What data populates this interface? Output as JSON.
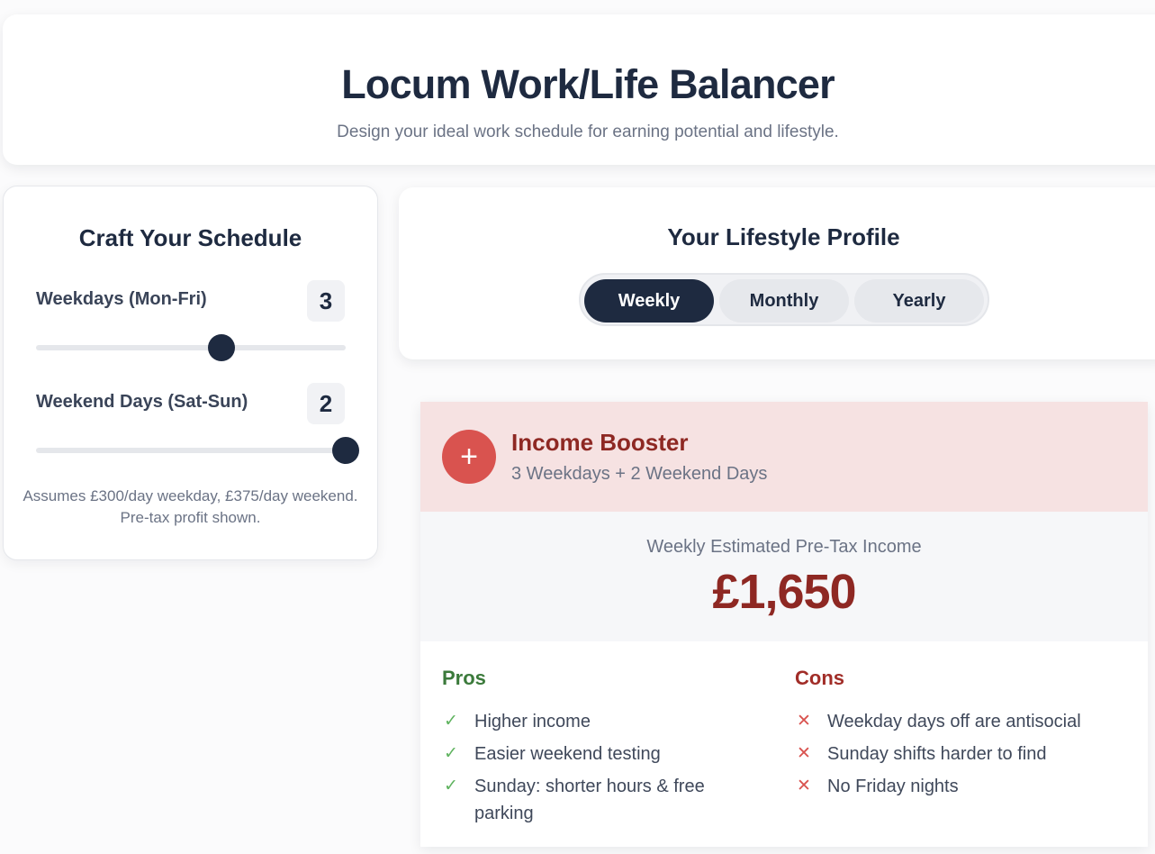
{
  "header": {
    "title": "Locum Work/Life Balancer",
    "subtitle": "Design your ideal work schedule for earning potential and lifestyle."
  },
  "schedule": {
    "title": "Craft Your Schedule",
    "weekdays": {
      "label": "Weekdays (Mon-Fri)",
      "value": "3",
      "level_fraction": 0.6
    },
    "weekend": {
      "label": "Weekend Days (Sat-Sun)",
      "value": "2",
      "level_fraction": 1.0
    },
    "assumption": "Assumes £300/day weekday, £375/day weekend. Pre-tax profit shown."
  },
  "profile": {
    "title": "Your Lifestyle Profile",
    "tabs": [
      {
        "label": "Weekly",
        "active": true
      },
      {
        "label": "Monthly",
        "active": false
      },
      {
        "label": "Yearly",
        "active": false
      }
    ]
  },
  "result": {
    "icon": "plus-icon",
    "title": "Income Booster",
    "subtitle": "3 Weekdays + 2 Weekend Days",
    "income_label": "Weekly Estimated Pre-Tax Income",
    "income_value": "£1,650",
    "pros_title": "Pros",
    "pros": [
      "Higher income",
      "Easier weekend testing",
      "Sunday: shorter hours & free parking"
    ],
    "cons_title": "Cons",
    "cons": [
      "Weekday days off are antisocial",
      "Sunday shifts harder to find",
      "No Friday nights"
    ]
  },
  "colors": {
    "navy": "#1e2a40",
    "accent_red": "#d9534f",
    "dark_red": "#8e2823",
    "pros_green": "#3b7a3b"
  }
}
